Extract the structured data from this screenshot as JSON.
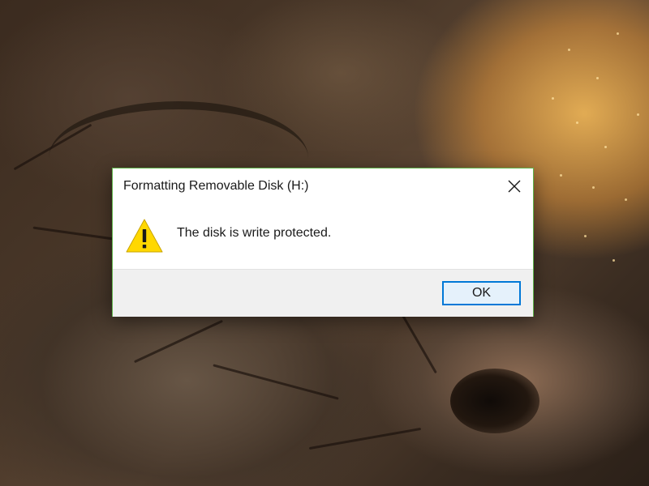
{
  "dialog": {
    "title": "Formatting Removable Disk (H:)",
    "message": "The disk is write protected.",
    "ok_label": "OK",
    "icon": "warning-icon",
    "close_icon": "close-icon",
    "accent_border": "#5fb34a",
    "default_button_border": "#0078d7"
  },
  "background": {
    "description_colors": [
      "#3b2b1f",
      "#5c4634",
      "#f0b45a"
    ]
  }
}
